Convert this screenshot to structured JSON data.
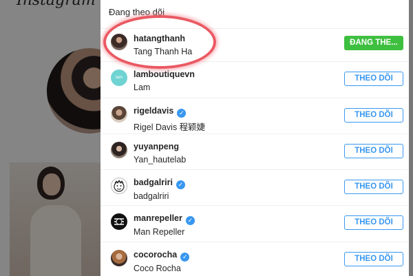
{
  "background": {
    "logo_text": "Instagram"
  },
  "modal": {
    "title": "Đang theo dõi",
    "accounts": [
      {
        "username": "hatangthanh",
        "full_name": "Tang Thanh Ha",
        "verified": false,
        "button": "ĐANG THE...",
        "state": "following"
      },
      {
        "username": "lamboutiquevn",
        "full_name": "Lam",
        "verified": false,
        "button": "THEO DÕI",
        "state": "follow",
        "avatar_text": "lam"
      },
      {
        "username": "rigeldavis",
        "full_name": "Rigel Davis 程颖婕",
        "verified": true,
        "button": "THEO DÕI",
        "state": "follow"
      },
      {
        "username": "yuyanpeng",
        "full_name": "Yan_hautelab",
        "verified": false,
        "button": "THEO DÕI",
        "state": "follow"
      },
      {
        "username": "badgalriri",
        "full_name": "badgalriri",
        "verified": true,
        "button": "THEO DÕI",
        "state": "follow"
      },
      {
        "username": "manrepeller",
        "full_name": "Man Repeller",
        "verified": true,
        "button": "THEO DÕI",
        "state": "follow"
      },
      {
        "username": "cocorocha",
        "full_name": "Coco Rocha",
        "verified": true,
        "button": "THEO DÕI",
        "state": "follow"
      }
    ]
  },
  "colors": {
    "follow_blue": "#3897f0",
    "following_green": "#3fbf40",
    "highlight_red": "#e63c46",
    "verified_blue": "#3897f0"
  },
  "icons": {
    "verified": "verified-badge-icon"
  }
}
